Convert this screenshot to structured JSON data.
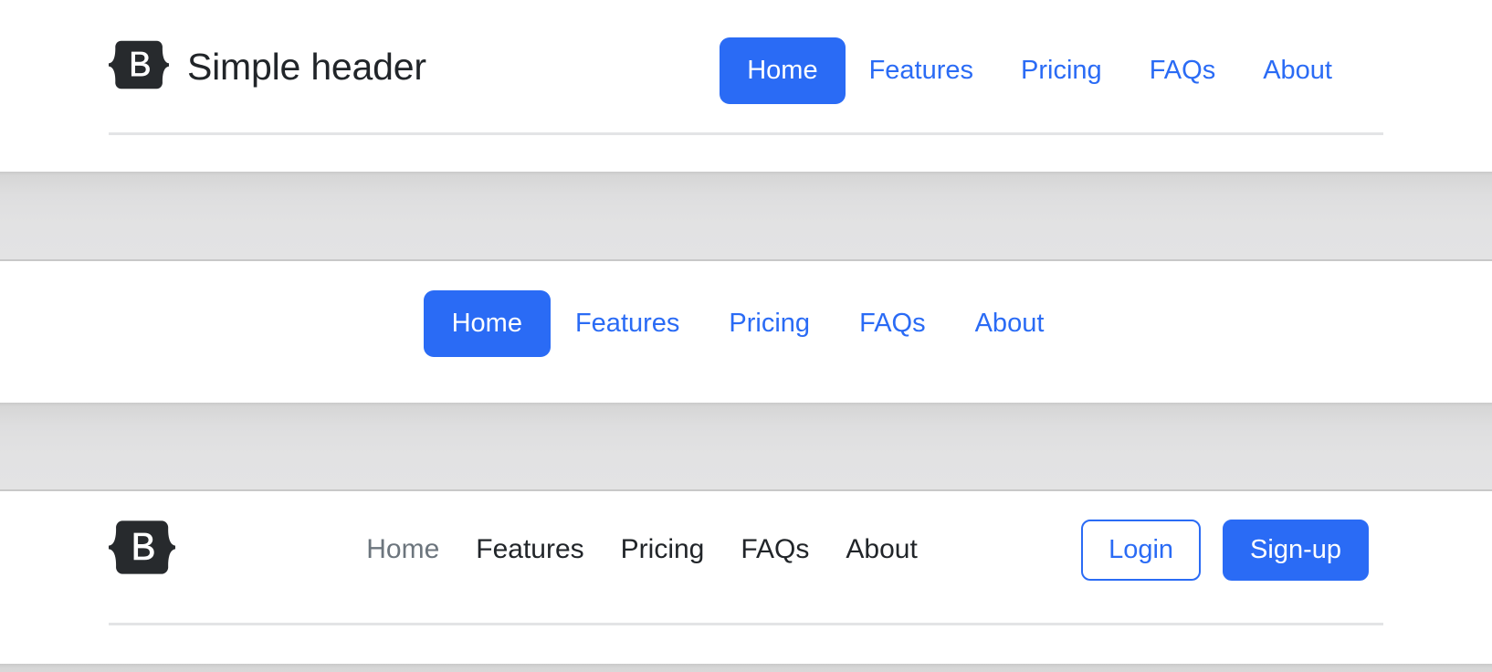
{
  "brand": {
    "logo_icon": "bootstrap-logo-icon",
    "logo_letter": "B",
    "title": "Simple header"
  },
  "colors": {
    "primary": "#2a6bf5",
    "dark": "#212529",
    "muted": "#6c757d",
    "rule": "#e3e4e6",
    "band": "#e0e0e1"
  },
  "header_one": {
    "nav": [
      {
        "label": "Home",
        "state": "active"
      },
      {
        "label": "Features",
        "state": "default"
      },
      {
        "label": "Pricing",
        "state": "default"
      },
      {
        "label": "FAQs",
        "state": "default"
      },
      {
        "label": "About",
        "state": "default"
      }
    ]
  },
  "header_two": {
    "nav": [
      {
        "label": "Home",
        "state": "active"
      },
      {
        "label": "Features",
        "state": "default"
      },
      {
        "label": "Pricing",
        "state": "default"
      },
      {
        "label": "FAQs",
        "state": "default"
      },
      {
        "label": "About",
        "state": "default"
      }
    ]
  },
  "header_three": {
    "logo_letter": "B",
    "nav": [
      {
        "label": "Home",
        "state": "muted"
      },
      {
        "label": "Features",
        "state": "default"
      },
      {
        "label": "Pricing",
        "state": "default"
      },
      {
        "label": "FAQs",
        "state": "default"
      },
      {
        "label": "About",
        "state": "default"
      }
    ],
    "buttons": {
      "login": "Login",
      "signup": "Sign-up"
    }
  }
}
